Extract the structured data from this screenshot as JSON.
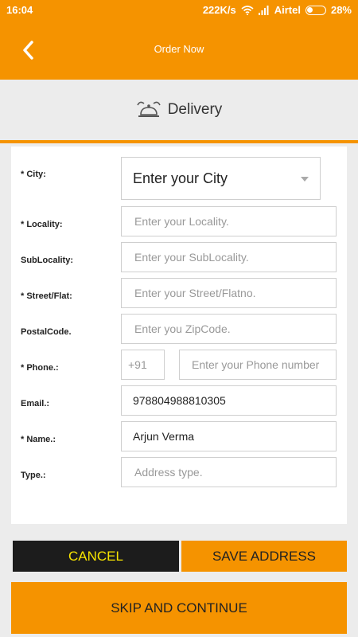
{
  "status_bar": {
    "time": "16:04",
    "speed": "222K/s",
    "carrier": "Airtel",
    "battery": "28%"
  },
  "app_bar": {
    "title": "Order Now"
  },
  "header": {
    "title": "Delivery"
  },
  "form": {
    "city": {
      "label": "* City:",
      "value": "Enter your City"
    },
    "locality": {
      "label": "* Locality:",
      "placeholder": "Enter your Locality."
    },
    "sublocality": {
      "label": "SubLocality:",
      "placeholder": "Enter your SubLocality."
    },
    "street": {
      "label": "* Street/Flat:",
      "placeholder": "Enter your Street/Flatno."
    },
    "postal": {
      "label": "PostalCode.",
      "placeholder": "Enter you ZipCode."
    },
    "phone": {
      "label": "* Phone.:",
      "code": "+91",
      "placeholder": "Enter your Phone number"
    },
    "email": {
      "label": "Email.:",
      "value": "978804988810305"
    },
    "name": {
      "label": "* Name.:",
      "value": "Arjun Verma"
    },
    "type": {
      "label": "Type.:",
      "placeholder": "Address type."
    }
  },
  "buttons": {
    "cancel": "CANCEL",
    "save": "SAVE ADDRESS",
    "skip": "SKIP AND CONTINUE"
  },
  "colors": {
    "accent": "#f59300",
    "cancel_bg": "#1c1c1c",
    "cancel_text": "#f7e400"
  },
  "icons": {
    "back": "back-chevron-icon",
    "delivery": "cloche-icon",
    "wifi": "wifi-icon",
    "signal": "signal-icon",
    "battery": "battery-icon",
    "dropdown": "chevron-down-icon"
  }
}
